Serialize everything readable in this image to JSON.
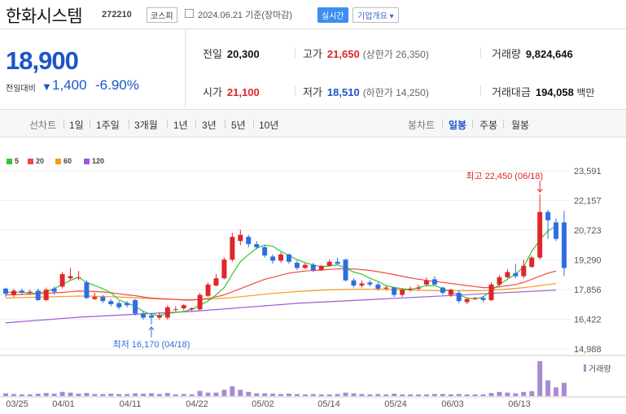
{
  "header": {
    "name": "한화시스템",
    "code": "272210",
    "market": "코스피",
    "date": "2024.06.21",
    "date_suffix": "기준(장마감)",
    "realtime_label": "실시간",
    "info_label": "기업개요"
  },
  "quote": {
    "price": "18,900",
    "change_label": "전일대비",
    "change": "1,400",
    "change_pct": "-6.90%"
  },
  "stats": {
    "prev_label": "전일",
    "prev": "20,300",
    "high_label": "고가",
    "high": "21,650",
    "upper_label": "(상한가",
    "upper": "26,350)",
    "volume_label": "거래량",
    "volume": "9,824,646",
    "open_label": "시가",
    "open": "21,100",
    "low_label": "저가",
    "low": "18,510",
    "lower_label": "(하한가",
    "lower": "14,250)",
    "amount_label": "거래대금",
    "amount": "194,058",
    "amount_unit": "백만"
  },
  "toolbar": {
    "line_chart": "선차트",
    "periods": [
      "1일",
      "1주일",
      "3개월",
      "1년",
      "3년",
      "5년",
      "10년"
    ],
    "candle_chart": "봉차트",
    "candle_periods": [
      "일봉",
      "주봉",
      "월봉"
    ],
    "active_candle": "일봉"
  },
  "legend": [
    {
      "label": "5",
      "color": "#35c435"
    },
    {
      "label": "20",
      "color": "#f04848"
    },
    {
      "label": "60",
      "color": "#f59a23"
    },
    {
      "label": "120",
      "color": "#9b59d9"
    }
  ],
  "chart_data": {
    "type": "candlestick",
    "y_ticks": [
      "23,591",
      "22,157",
      "20,723",
      "19,290",
      "17,856",
      "16,422",
      "14,988"
    ],
    "ylim": [
      14988,
      23591
    ],
    "x_labels": [
      "03/25",
      "04/01",
      "04/11",
      "04/22",
      "05/02",
      "05/14",
      "05/24",
      "06/03",
      "06/13"
    ],
    "annotation_high": "최고 22,450 (06/18)",
    "annotation_low": "최저 16,170 (04/18)",
    "volume_label": "거래량",
    "candles": [
      {
        "d": "03/25",
        "o": 17900,
        "c": 17650,
        "h": 17950,
        "l": 17500,
        "v": 0.08
      },
      {
        "d": "03/26",
        "o": 17600,
        "c": 17800,
        "h": 17900,
        "l": 17500,
        "v": 0.06
      },
      {
        "d": "03/27",
        "o": 17800,
        "c": 17700,
        "h": 17900,
        "l": 17600,
        "v": 0.05
      },
      {
        "d": "03/28",
        "o": 17700,
        "c": 17750,
        "h": 17850,
        "l": 17600,
        "v": 0.05
      },
      {
        "d": "03/29",
        "o": 17800,
        "c": 17350,
        "h": 17900,
        "l": 17300,
        "v": 0.07
      },
      {
        "d": "04/01",
        "o": 17350,
        "c": 17850,
        "h": 17950,
        "l": 17300,
        "v": 0.09
      },
      {
        "d": "04/02",
        "o": 17900,
        "c": 17750,
        "h": 18000,
        "l": 17600,
        "v": 0.07
      },
      {
        "d": "04/03",
        "o": 18000,
        "c": 18600,
        "h": 18700,
        "l": 17900,
        "v": 0.12
      },
      {
        "d": "04/04",
        "o": 18400,
        "c": 18500,
        "h": 18900,
        "l": 18300,
        "v": 0.1
      },
      {
        "d": "04/05",
        "o": 18450,
        "c": 18450,
        "h": 18750,
        "l": 18300,
        "v": 0.07
      },
      {
        "d": "04/08",
        "o": 18200,
        "c": 17450,
        "h": 18300,
        "l": 17400,
        "v": 0.09
      },
      {
        "d": "04/09",
        "o": 17400,
        "c": 17500,
        "h": 17700,
        "l": 17350,
        "v": 0.06
      },
      {
        "d": "04/10",
        "o": 17500,
        "c": 17300,
        "h": 17600,
        "l": 17200,
        "v": 0.06
      },
      {
        "d": "04/11",
        "o": 17300,
        "c": 17150,
        "h": 17400,
        "l": 17050,
        "v": 0.07
      },
      {
        "d": "04/12",
        "o": 17200,
        "c": 17000,
        "h": 17300,
        "l": 16900,
        "v": 0.06
      },
      {
        "d": "04/15",
        "o": 17200,
        "c": 17100,
        "h": 17300,
        "l": 17000,
        "v": 0.06
      },
      {
        "d": "04/16",
        "o": 17350,
        "c": 16700,
        "h": 17400,
        "l": 16600,
        "v": 0.08
      },
      {
        "d": "04/17",
        "o": 16700,
        "c": 16500,
        "h": 16800,
        "l": 16400,
        "v": 0.07
      },
      {
        "d": "04/18",
        "o": 16600,
        "c": 16500,
        "h": 16700,
        "l": 16170,
        "v": 0.08
      },
      {
        "d": "04/19",
        "o": 16500,
        "c": 16600,
        "h": 16750,
        "l": 16400,
        "v": 0.06
      },
      {
        "d": "04/22",
        "o": 16500,
        "c": 17000,
        "h": 17100,
        "l": 16400,
        "v": 0.09
      },
      {
        "d": "04/23",
        "o": 16900,
        "c": 16900,
        "h": 17050,
        "l": 16800,
        "v": 0.05
      },
      {
        "d": "04/24",
        "o": 16950,
        "c": 17100,
        "h": 17150,
        "l": 16850,
        "v": 0.06
      },
      {
        "d": "04/25",
        "o": 16900,
        "c": 16950,
        "h": 17000,
        "l": 16800,
        "v": 0.05
      },
      {
        "d": "04/26",
        "o": 16900,
        "c": 17600,
        "h": 17700,
        "l": 16850,
        "v": 0.15
      },
      {
        "d": "04/29",
        "o": 17550,
        "c": 18100,
        "h": 18200,
        "l": 17500,
        "v": 0.1
      },
      {
        "d": "04/30",
        "o": 18050,
        "c": 18400,
        "h": 18600,
        "l": 18000,
        "v": 0.1
      },
      {
        "d": "05/01",
        "o": 18400,
        "c": 19300,
        "h": 19400,
        "l": 18350,
        "v": 0.18
      },
      {
        "d": "05/02",
        "o": 19300,
        "c": 20400,
        "h": 20600,
        "l": 19200,
        "v": 0.28
      },
      {
        "d": "05/03",
        "o": 20200,
        "c": 20500,
        "h": 20750,
        "l": 20000,
        "v": 0.18
      },
      {
        "d": "05/07",
        "o": 20400,
        "c": 20050,
        "h": 20500,
        "l": 19900,
        "v": 0.12
      },
      {
        "d": "05/08",
        "o": 20050,
        "c": 19900,
        "h": 20200,
        "l": 19800,
        "v": 0.08
      },
      {
        "d": "05/09",
        "o": 19900,
        "c": 19500,
        "h": 20000,
        "l": 19400,
        "v": 0.08
      },
      {
        "d": "05/10",
        "o": 19450,
        "c": 19250,
        "h": 19550,
        "l": 19100,
        "v": 0.07
      },
      {
        "d": "05/13",
        "o": 19250,
        "c": 19550,
        "h": 19650,
        "l": 19150,
        "v": 0.06
      },
      {
        "d": "05/14",
        "o": 19550,
        "c": 19200,
        "h": 19600,
        "l": 19100,
        "v": 0.07
      },
      {
        "d": "05/16",
        "o": 19150,
        "c": 18900,
        "h": 19250,
        "l": 18800,
        "v": 0.06
      },
      {
        "d": "05/17",
        "o": 18900,
        "c": 19050,
        "h": 19150,
        "l": 18850,
        "v": 0.05
      },
      {
        "d": "05/20",
        "o": 19050,
        "c": 18800,
        "h": 19150,
        "l": 18700,
        "v": 0.06
      },
      {
        "d": "05/21",
        "o": 18800,
        "c": 19000,
        "h": 19050,
        "l": 18750,
        "v": 0.05
      },
      {
        "d": "05/22",
        "o": 19000,
        "c": 19200,
        "h": 19300,
        "l": 18950,
        "v": 0.05
      },
      {
        "d": "05/23",
        "o": 19200,
        "c": 19100,
        "h": 19400,
        "l": 19050,
        "v": 0.06
      },
      {
        "d": "05/24",
        "o": 19300,
        "c": 18300,
        "h": 19350,
        "l": 18250,
        "v": 0.1
      },
      {
        "d": "05/27",
        "o": 18300,
        "c": 18050,
        "h": 18400,
        "l": 17950,
        "v": 0.08
      },
      {
        "d": "05/28",
        "o": 18050,
        "c": 18150,
        "h": 18300,
        "l": 17950,
        "v": 0.06
      },
      {
        "d": "05/29",
        "o": 18200,
        "c": 18100,
        "h": 18300,
        "l": 18000,
        "v": 0.05
      },
      {
        "d": "05/30",
        "o": 18100,
        "c": 17900,
        "h": 18200,
        "l": 17800,
        "v": 0.06
      },
      {
        "d": "05/31",
        "o": 17900,
        "c": 17950,
        "h": 18050,
        "l": 17800,
        "v": 0.05
      },
      {
        "d": "06/03",
        "o": 17950,
        "c": 17600,
        "h": 18000,
        "l": 17500,
        "v": 0.07
      },
      {
        "d": "06/04",
        "o": 17600,
        "c": 17850,
        "h": 17900,
        "l": 17500,
        "v": 0.05
      },
      {
        "d": "06/05",
        "o": 17850,
        "c": 17900,
        "h": 18000,
        "l": 17750,
        "v": 0.05
      },
      {
        "d": "06/07",
        "o": 17900,
        "c": 17950,
        "h": 18100,
        "l": 17800,
        "v": 0.05
      },
      {
        "d": "06/10",
        "o": 18100,
        "c": 18300,
        "h": 18450,
        "l": 18000,
        "v": 0.05
      },
      {
        "d": "06/11",
        "o": 18350,
        "c": 18100,
        "h": 18500,
        "l": 18050,
        "v": 0.06
      },
      {
        "d": "06/12",
        "o": 17950,
        "c": 17700,
        "h": 18000,
        "l": 17600,
        "v": 0.06
      },
      {
        "d": "06/13",
        "o": 17600,
        "c": 17850,
        "h": 17900,
        "l": 17500,
        "v": 0.05
      },
      {
        "d": "06/14",
        "o": 17700,
        "c": 17300,
        "h": 17800,
        "l": 17200,
        "v": 0.06
      },
      {
        "d": "06/17",
        "o": 17250,
        "c": 17400,
        "h": 17450,
        "l": 17150,
        "v": 0.05
      },
      {
        "d": "06/18",
        "o": 17400,
        "c": 17450,
        "h": 17500,
        "l": 17350,
        "v": 0.05
      },
      {
        "d": "06/19",
        "o": 17450,
        "c": 17350,
        "h": 17550,
        "l": 17250,
        "v": 0.05
      },
      {
        "d": "06/20",
        "o": 17350,
        "c": 18100,
        "h": 18200,
        "l": 17300,
        "v": 0.09
      },
      {
        "d": "06/21",
        "o": 18100,
        "c": 18450,
        "h": 18550,
        "l": 18000,
        "v": 0.12
      },
      {
        "d": "06/24",
        "o": 18450,
        "c": 18700,
        "h": 18850,
        "l": 18400,
        "v": 0.1
      },
      {
        "d": "06/25",
        "o": 18650,
        "c": 18500,
        "h": 19100,
        "l": 18400,
        "v": 0.08
      },
      {
        "d": "06/26",
        "o": 18500,
        "c": 19000,
        "h": 19300,
        "l": 18400,
        "v": 0.12
      },
      {
        "d": "06/27",
        "o": 18950,
        "c": 19400,
        "h": 19500,
        "l": 18900,
        "v": 0.14
      },
      {
        "d": "06/28",
        "o": 19400,
        "c": 21600,
        "h": 22450,
        "l": 19300,
        "v": 1.0
      },
      {
        "d": "07/01",
        "o": 21600,
        "c": 21200,
        "h": 21700,
        "l": 20300,
        "v": 0.45
      },
      {
        "d": "07/02",
        "o": 21100,
        "c": 20300,
        "h": 21300,
        "l": 20200,
        "v": 0.25
      },
      {
        "d": "07/03",
        "o": 21100,
        "c": 18900,
        "h": 21650,
        "l": 18510,
        "v": 0.38
      }
    ],
    "ma5": [
      17750,
      17700,
      17760,
      17650,
      17700,
      17750,
      17900,
      18100,
      18300,
      18450,
      18200,
      18050,
      17900,
      17700,
      17350,
      17200,
      17050,
      16800,
      16650,
      16600,
      16700,
      16750,
      16800,
      16900,
      17100,
      17300,
      17600,
      17950,
      18600,
      19200,
      19550,
      19850,
      20000,
      19950,
      19700,
      19500,
      19300,
      19150,
      19050,
      18950,
      19000,
      19050,
      18900,
      18700,
      18600,
      18400,
      18250,
      18050,
      17950,
      17900,
      17850,
      17950,
      18050,
      18050,
      17900,
      17750,
      17600,
      17450,
      17400,
      17500,
      17800,
      18100,
      18350,
      18600,
      18950,
      19700,
      20250,
      20700,
      20900
    ],
    "ma20": [
      17600,
      17600,
      17620,
      17630,
      17650,
      17670,
      17700,
      17720,
      17750,
      17780,
      17770,
      17760,
      17740,
      17700,
      17650,
      17600,
      17560,
      17500,
      17450,
      17420,
      17400,
      17380,
      17350,
      17350,
      17380,
      17420,
      17500,
      17600,
      17750,
      17900,
      18050,
      18200,
      18350,
      18450,
      18550,
      18650,
      18700,
      18750,
      18780,
      18800,
      18830,
      18850,
      18860,
      18850,
      18820,
      18780,
      18720,
      18650,
      18580,
      18500,
      18420,
      18350,
      18300,
      18250,
      18200,
      18150,
      18100,
      18050,
      18000,
      17950,
      17950,
      17980,
      18050,
      18100,
      18200,
      18350,
      18500,
      18650,
      18750
    ],
    "ma60": [
      17450,
      17460,
      17470,
      17480,
      17490,
      17500,
      17510,
      17520,
      17530,
      17540,
      17540,
      17530,
      17520,
      17510,
      17500,
      17480,
      17460,
      17440,
      17420,
      17400,
      17390,
      17380,
      17370,
      17370,
      17380,
      17390,
      17410,
      17440,
      17470,
      17510,
      17550,
      17590,
      17630,
      17670,
      17700,
      17730,
      17760,
      17780,
      17800,
      17820,
      17840,
      17850,
      17860,
      17870,
      17870,
      17870,
      17870,
      17860,
      17850,
      17840,
      17830,
      17820,
      17810,
      17800,
      17800,
      17800,
      17800,
      17800,
      17800,
      17810,
      17830,
      17850,
      17880,
      17910,
      17950,
      18000,
      18050,
      18100,
      18150
    ],
    "ma120": [
      16250,
      16280,
      16310,
      16340,
      16370,
      16400,
      16430,
      16460,
      16490,
      16520,
      16540,
      16560,
      16580,
      16600,
      16620,
      16640,
      16660,
      16680,
      16700,
      16720,
      16740,
      16760,
      16780,
      16800,
      16830,
      16860,
      16890,
      16920,
      16950,
      16980,
      17010,
      17040,
      17070,
      17100,
      17130,
      17160,
      17190,
      17210,
      17230,
      17250,
      17270,
      17290,
      17310,
      17330,
      17350,
      17370,
      17390,
      17410,
      17430,
      17450,
      17470,
      17490,
      17510,
      17530,
      17550,
      17570,
      17590,
      17610,
      17630,
      17650,
      17670,
      17690,
      17710,
      17730,
      17750,
      17770,
      17790,
      17810,
      17830
    ]
  }
}
